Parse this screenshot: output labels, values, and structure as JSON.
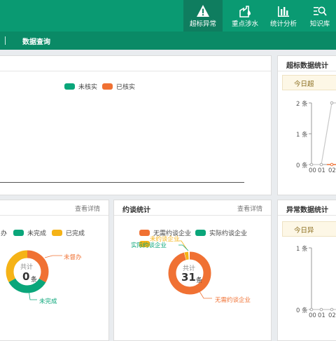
{
  "nav": {
    "items": [
      {
        "label": "超标异常",
        "icon": "warning-icon",
        "active": true
      },
      {
        "label": "重点涉水",
        "icon": "factory-water-icon",
        "active": false
      },
      {
        "label": "统计分析",
        "icon": "bar-chart-icon",
        "active": false
      },
      {
        "label": "知识库",
        "icon": "search-list-icon",
        "active": false
      }
    ]
  },
  "subnav": {
    "query_label": "数据查询"
  },
  "main_chart": {
    "legend": [
      {
        "label": "未核实",
        "color": "#0aa67a"
      },
      {
        "label": "已核实",
        "color": "#f07133"
      }
    ]
  },
  "exceed_stats": {
    "title": "超标数据统计",
    "today": "今日超",
    "y_ticks": [
      "2 条",
      "1 条",
      "0 条"
    ],
    "x_ticks": [
      "00",
      "01",
      "02"
    ]
  },
  "task_panel": {
    "more": "查看详情",
    "legend": [
      {
        "label": "办",
        "color": "#f07133"
      },
      {
        "label": "未完成",
        "color": "#0aa67a"
      },
      {
        "label": "已完成",
        "color": "#f5b317"
      }
    ],
    "center_label": "共计",
    "center_value": "0",
    "center_unit": "条",
    "annotations": {
      "pending": "未督办",
      "unfinished": "未完成"
    }
  },
  "interview_panel": {
    "title": "约谈统计",
    "more": "查看详情",
    "legend": [
      {
        "label": "无需约谈企业",
        "color": "#f07133"
      },
      {
        "label": "实际约谈企业",
        "color": "#0aa67a"
      },
      {
        "label": "未约谈企业",
        "color": "#f5b317"
      }
    ],
    "center_label": "共计",
    "center_value": "31",
    "center_unit": "条",
    "annotations": {
      "none_needed": "无需约谈企业",
      "not_interviewed": "未约谈企业",
      "actual": "实际约谈企业"
    }
  },
  "abnormal_stats": {
    "title": "异常数据统计",
    "today": "今日异",
    "y_ticks": [
      "1 条",
      "0 条"
    ],
    "x_ticks": [
      "00",
      "01",
      "02"
    ]
  }
}
